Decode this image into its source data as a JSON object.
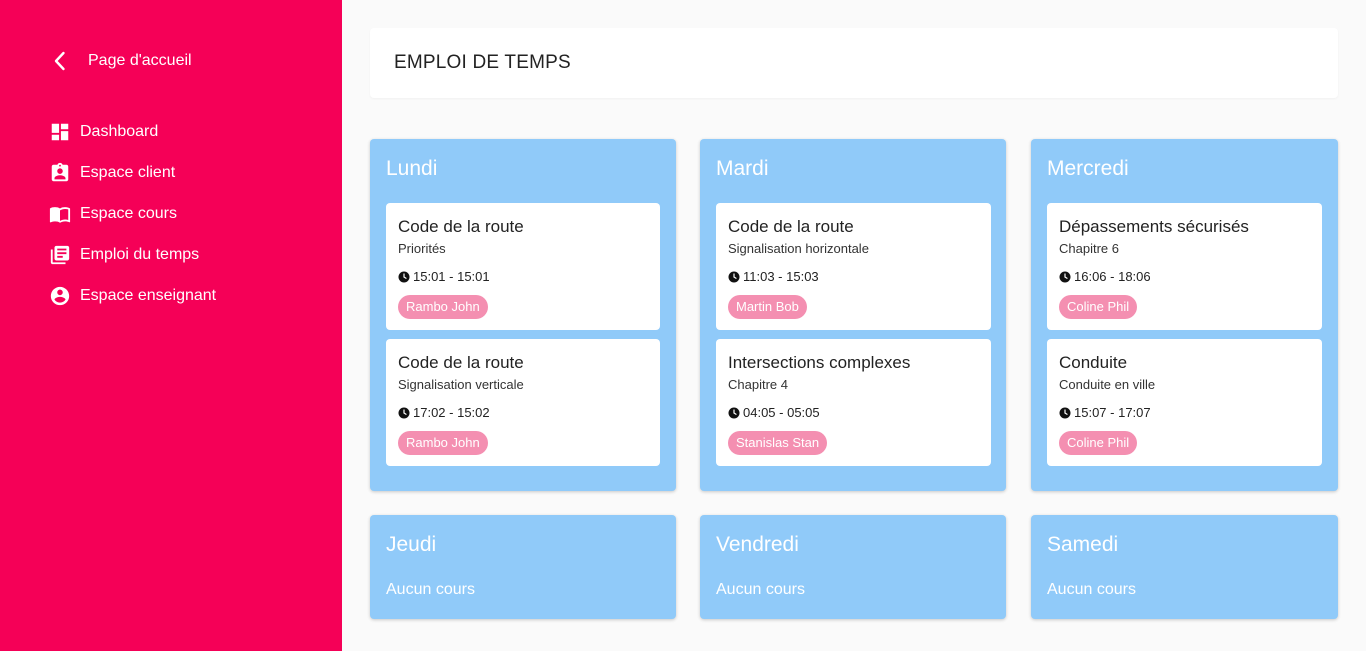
{
  "sidebar": {
    "back_label": "Page d'accueil",
    "items": [
      {
        "label": "Dashboard",
        "icon": "dashboard-icon"
      },
      {
        "label": "Espace client",
        "icon": "assignment-ind-icon"
      },
      {
        "label": "Espace cours",
        "icon": "menu-book-icon"
      },
      {
        "label": "Emploi du temps",
        "icon": "library-books-icon"
      },
      {
        "label": "Espace enseignant",
        "icon": "account-circle-icon"
      }
    ]
  },
  "header": {
    "title": "EMPLOI DE TEMPS"
  },
  "days": [
    {
      "name": "Lundi",
      "courses": [
        {
          "title": "Code de la route",
          "subtitle": "Priorités",
          "time": "15:01 - 15:01",
          "teacher": "Rambo John"
        },
        {
          "title": "Code de la route",
          "subtitle": "Signalisation verticale",
          "time": "17:02 - 15:02",
          "teacher": "Rambo John"
        }
      ]
    },
    {
      "name": "Mardi",
      "courses": [
        {
          "title": "Code de la route",
          "subtitle": "Signalisation horizontale",
          "time": "11:03 - 15:03",
          "teacher": "Martin Bob"
        },
        {
          "title": "Intersections complexes",
          "subtitle": "Chapitre 4",
          "time": "04:05 - 05:05",
          "teacher": "Stanislas Stan"
        }
      ]
    },
    {
      "name": "Mercredi",
      "courses": [
        {
          "title": "Dépassements sécurisés",
          "subtitle": "Chapitre 6",
          "time": "16:06 - 18:06",
          "teacher": "Coline Phil"
        },
        {
          "title": "Conduite",
          "subtitle": "Conduite en ville",
          "time": "15:07 - 17:07",
          "teacher": "Coline Phil"
        }
      ]
    },
    {
      "name": "Jeudi",
      "empty": "Aucun cours"
    },
    {
      "name": "Vendredi",
      "empty": "Aucun cours"
    },
    {
      "name": "Samedi",
      "empty": "Aucun cours"
    }
  ],
  "colors": {
    "sidebar": "#f50057",
    "day_card": "#90caf9",
    "chip": "#f48fb1"
  }
}
